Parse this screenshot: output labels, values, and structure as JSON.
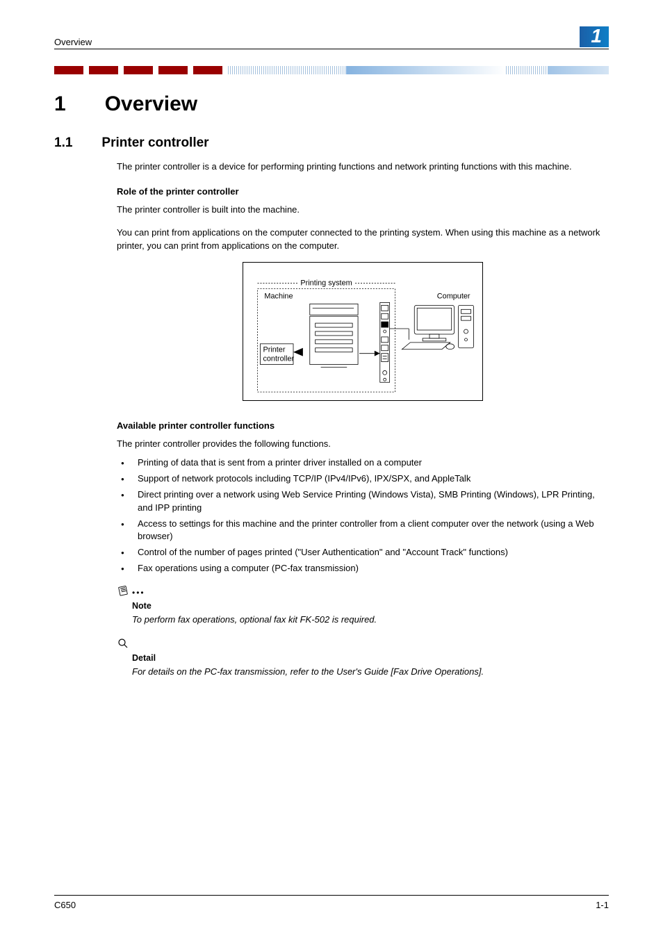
{
  "header": {
    "running_head": "Overview",
    "chapter_badge": "1"
  },
  "h1": {
    "num": "1",
    "title": "Overview"
  },
  "h2": {
    "num": "1.1",
    "title": "Printer controller"
  },
  "intro_p": "The printer controller is a device for performing printing functions and network printing functions with this machine.",
  "role": {
    "heading": "Role of the printer controller",
    "p1": "The printer controller is built into the machine.",
    "p2": "You can print from applications on the computer connected to the printing system. When using this machine as a network printer, you can print from applications on the computer."
  },
  "diagram": {
    "heading": "Printing system",
    "machine_label": "Machine",
    "printer_ctrl_line1": "Printer",
    "printer_ctrl_line2": "controller",
    "computer_label": "Computer"
  },
  "functions": {
    "heading": "Available printer controller functions",
    "lead": "The printer controller provides the following functions.",
    "items": [
      "Printing of data that is sent from a printer driver installed on a computer",
      "Support of network protocols including TCP/IP (IPv4/IPv6), IPX/SPX, and AppleTalk",
      "Direct printing over a network using Web Service Printing (Windows Vista), SMB Printing (Windows), LPR Printing, and IPP printing",
      "Access to settings for this machine and the printer controller from a client computer over the network (using a Web browser)",
      "Control of the number of pages printed (\"User Authentication\" and \"Account Track\" functions)",
      "Fax operations using a computer (PC-fax transmission)"
    ]
  },
  "note": {
    "title": "Note",
    "body": "To perform fax operations, optional fax kit FK-502 is required."
  },
  "detail": {
    "title": "Detail",
    "body": "For details on the PC-fax transmission, refer to the User's Guide [Fax Drive Operations]."
  },
  "footer": {
    "left": "C650",
    "right": "1-1"
  }
}
